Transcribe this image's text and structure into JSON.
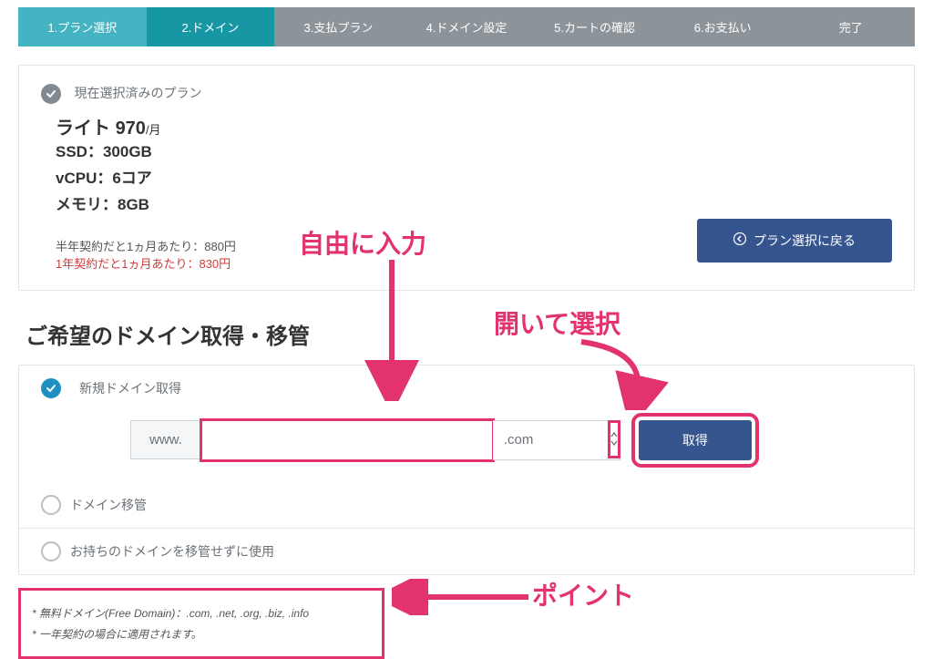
{
  "steps": [
    "1.プラン選択",
    "2.ドメイン",
    "3.支払プラン",
    "4.ドメイン設定",
    "5.カートの確認",
    "6.お支払い",
    "完了"
  ],
  "plan": {
    "current_label": "現在選択済みのプラン",
    "name": "ライト",
    "price": "970",
    "price_unit": "/月",
    "specs": [
      "SSD：300GB",
      "vCPU：6コア",
      "メモリ：8GB"
    ],
    "half_year_note": "半年契約だと1ヵ月あたり：880円",
    "one_year_note": "1年契約だと1ヵ月あたり：830円",
    "back_button": "プラン選択に戻る"
  },
  "domain": {
    "section_title": "ご希望のドメイン取得・移管",
    "new_label": "新規ドメイン取得",
    "prefix": "www.",
    "tld_value": ".com",
    "get_button": "取得",
    "transfer_label": "ドメイン移管",
    "keep_label": "お持ちのドメインを移管せずに使用"
  },
  "notes": {
    "line1": "* 無料ドメイン(Free Domain)：.com, .net, .org, .biz, .info",
    "line2": "* 一年契約の場合に適用されます。"
  },
  "annotations": {
    "input_label": "自由に入力",
    "select_label": "開いて選択",
    "point_label": "ポイント"
  }
}
